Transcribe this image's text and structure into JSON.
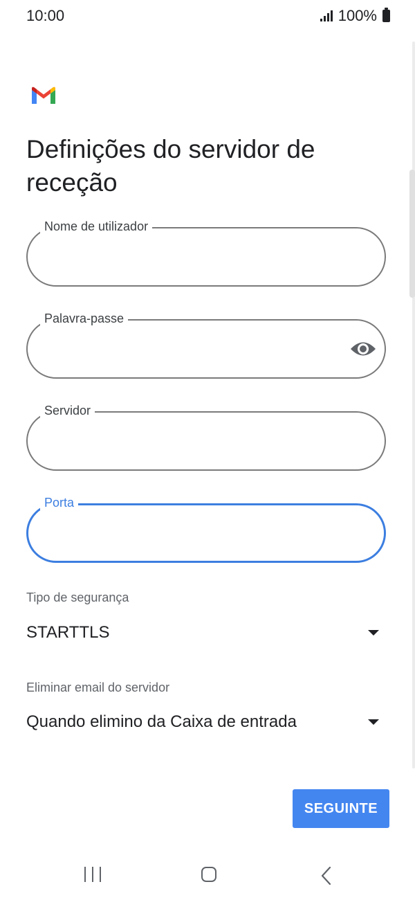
{
  "status_bar": {
    "time": "10:00",
    "battery": "100%"
  },
  "app": {
    "logo_icon": "gmail-logo-icon",
    "title": "Definições do servidor de receção"
  },
  "fields": {
    "username": {
      "label": "Nome de utilizador",
      "value": ""
    },
    "password": {
      "label": "Palavra-passe",
      "value": "",
      "toggle_icon": "eye-icon"
    },
    "server": {
      "label": "Servidor",
      "value": ""
    },
    "port": {
      "label": "Porta",
      "value": "",
      "focused": true
    }
  },
  "security": {
    "label": "Tipo de segurança",
    "value": "STARTTLS"
  },
  "delete_email": {
    "label": "Eliminar email do servidor",
    "value": "Quando elimino da Caixa de entrada"
  },
  "actions": {
    "next_label": "SEGUINTE"
  },
  "colors": {
    "accent": "#3c7ee0",
    "button": "#4486f0",
    "text": "#202124",
    "muted": "#5f6368"
  },
  "nav": {
    "icons": [
      "recents-icon",
      "home-icon",
      "back-icon"
    ]
  }
}
